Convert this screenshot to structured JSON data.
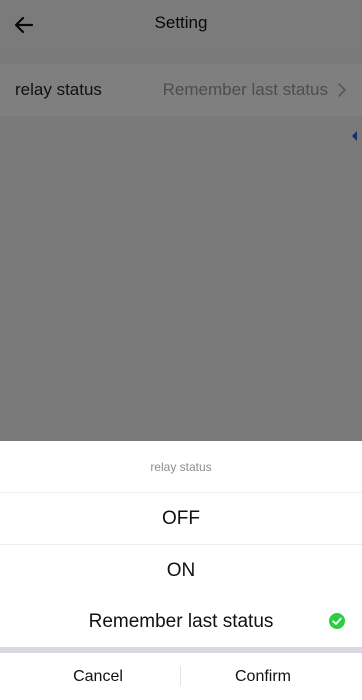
{
  "header": {
    "title": "Setting",
    "back_icon": "arrow-left-icon"
  },
  "settings": {
    "relay": {
      "label": "relay status",
      "value": "Remember last status",
      "chevron_icon": "chevron-right-icon"
    }
  },
  "sheet": {
    "title": "relay status",
    "options": [
      {
        "label": "OFF",
        "selected": false
      },
      {
        "label": "ON",
        "selected": false
      },
      {
        "label": "Remember last status",
        "selected": true
      }
    ],
    "check_icon": "check-circle-icon",
    "check_color": "#2ecc40",
    "cancel_label": "Cancel",
    "confirm_label": "Confirm"
  },
  "colors": {
    "overlay": "rgba(0,0,0,0.5)",
    "accent_handle": "#3b5bdb"
  }
}
